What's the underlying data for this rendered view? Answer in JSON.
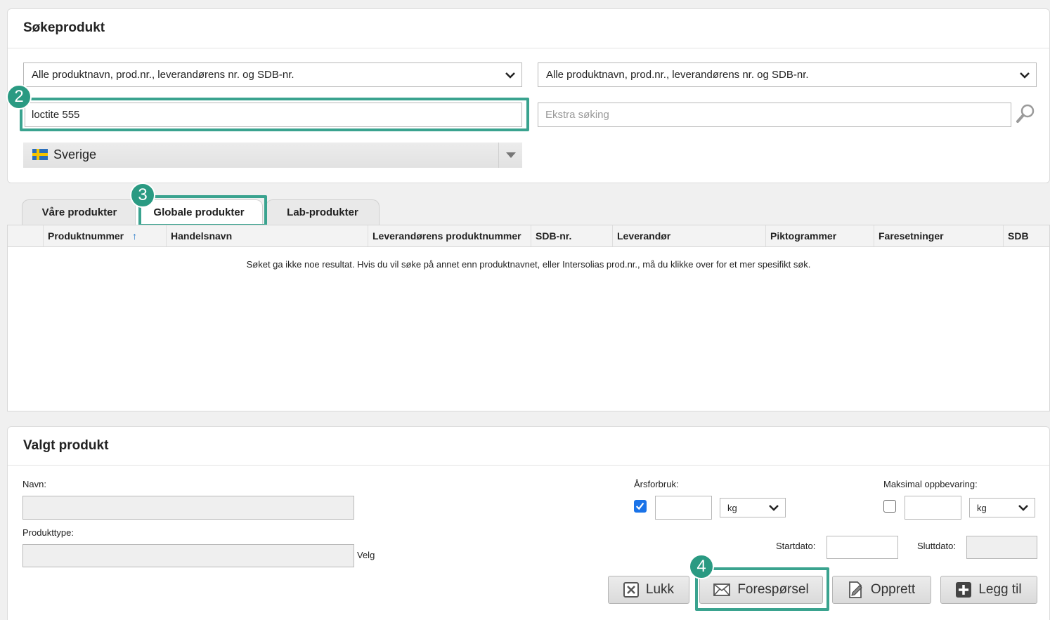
{
  "search_panel": {
    "title": "Søkeprodukt",
    "filter_left": "Alle produktnavn, prod.nr., leverandørens nr. og SDB-nr.",
    "filter_right": "Alle produktnavn, prod.nr., leverandørens nr. og SDB-nr.",
    "search_value": "loctite 555",
    "extra_placeholder": "Ekstra søking",
    "country": "Sverige"
  },
  "badges": {
    "step2": "2",
    "step3": "3",
    "step4": "4"
  },
  "tabs": [
    {
      "label": "Våre produkter"
    },
    {
      "label": "Globale produkter"
    },
    {
      "label": "Lab-produkter"
    }
  ],
  "grid": {
    "columns": [
      "Produktnummer",
      "Handelsnavn",
      "Leverandørens produktnummer",
      "SDB-nr.",
      "Leverandør",
      "Piktogrammer",
      "Faresetninger",
      "SDB"
    ],
    "sort_indicator": "↑",
    "empty_message": "Søket ga ikke noe resultat. Hvis du vil søke på annet enn produktnavnet, eller Intersolias prod.nr., må du klikke over for et mer spesifikt søk."
  },
  "selected_panel": {
    "title": "Valgt produkt",
    "name_label": "Navn:",
    "type_label": "Produkttype:",
    "choose_link": "Velg",
    "annual_label": "Årsforbruk:",
    "annual_unit": "kg",
    "storage_label": "Maksimal oppbevaring:",
    "storage_unit": "kg",
    "start_label": "Startdato:",
    "end_label": "Sluttdato:"
  },
  "buttons": {
    "close": "Lukk",
    "request": "Forespørsel",
    "create": "Opprett",
    "add": "Legg til"
  },
  "colors": {
    "highlight": "#3aa38f",
    "badge": "#2a9a82",
    "checkbox": "#1a73e8"
  }
}
